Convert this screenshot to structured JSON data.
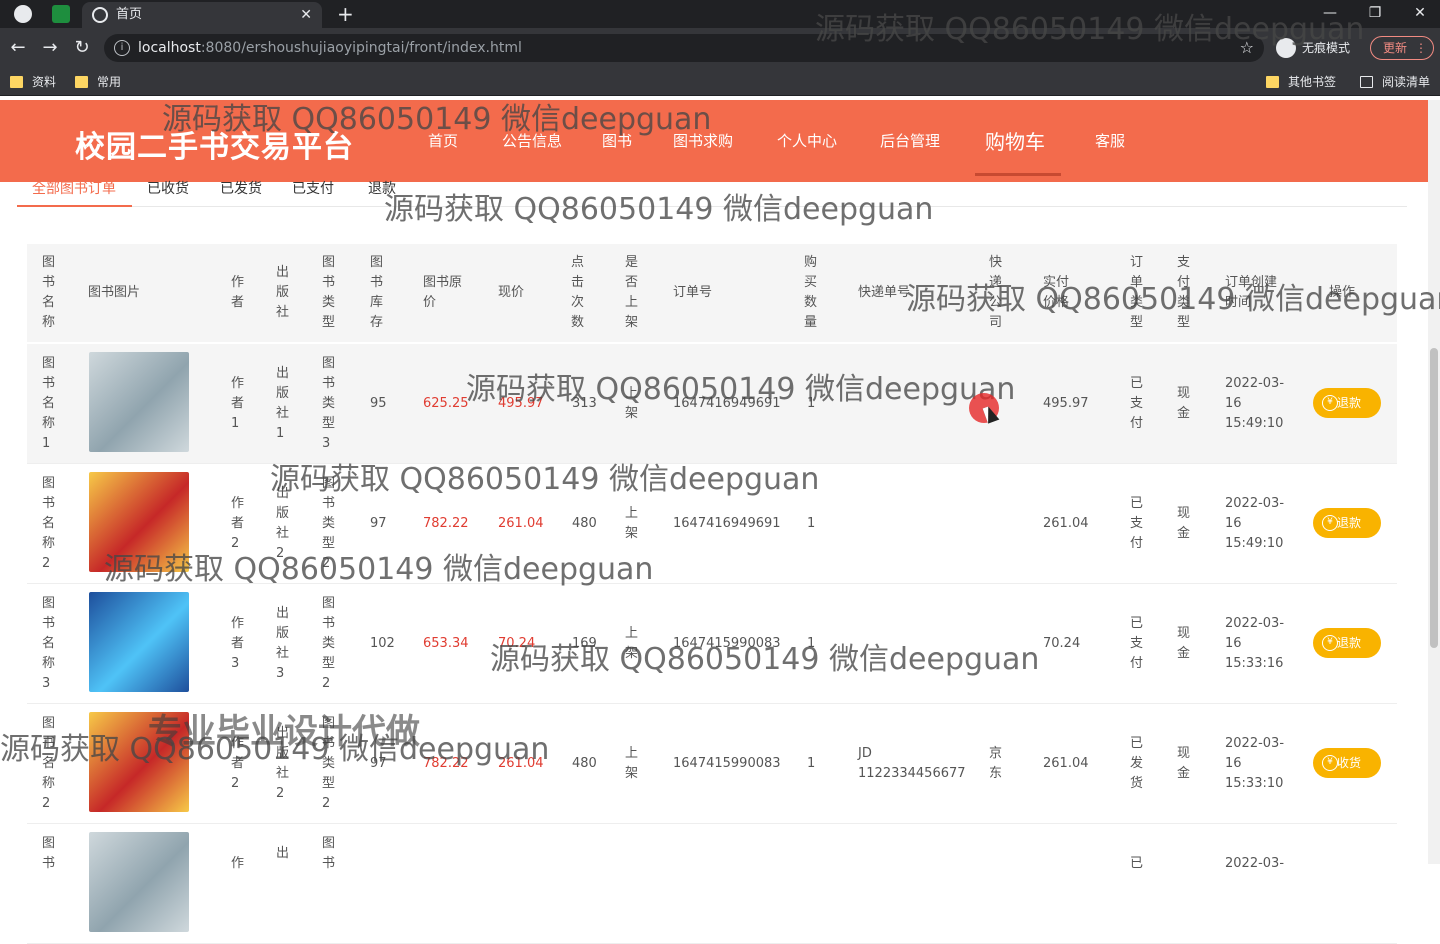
{
  "browser": {
    "tab_title": "首页",
    "url_host": "localhost",
    "url_path": ":8080/ershoushujiaoyipingtai/front/index.html",
    "incognito_label": "无痕模式",
    "update_label": "更新",
    "bookmarks": [
      "资料",
      "常用"
    ],
    "bookmarks_right": [
      "其他书签",
      "阅读清单"
    ]
  },
  "site": {
    "title": "校园二手书交易平台",
    "nav": [
      "首页",
      "公告信息",
      "图书",
      "图书求购",
      "个人中心",
      "后台管理",
      "购物车",
      "客服"
    ],
    "active_nav": "购物车"
  },
  "order_tabs": [
    "全部图书订单",
    "已收货",
    "已发货",
    "已支付",
    "退款"
  ],
  "table": {
    "headers": [
      "图书名称",
      "图书图片",
      "作者",
      "出版社",
      "图书类型",
      "图书库存",
      "图书原价",
      "现价",
      "点击次数",
      "是否上架",
      "订单号",
      "购买数量",
      "快递单号",
      "快递公司",
      "实付价格",
      "订单类型",
      "支付类型",
      "订单创建时间",
      "操作"
    ],
    "rows": [
      {
        "name": "图书名称1",
        "author": "作者1",
        "publisher": "出版社1",
        "type": "图书类型3",
        "stock": "95",
        "original": "625.25",
        "price": "495.97",
        "clicks": "313",
        "listed": "上架",
        "order_no": "1647416949691",
        "qty": "1",
        "tracking": "",
        "courier": "",
        "paid": "495.97",
        "order_type": "已支付",
        "pay_type": "现金",
        "created_date": "2022-03-",
        "created_day": "16",
        "created_time": "15:49:10",
        "action": "退款"
      },
      {
        "name": "图书名称2",
        "author": "作者2",
        "publisher": "出版社2",
        "type": "图书类型2",
        "stock": "97",
        "original": "782.22",
        "price": "261.04",
        "clicks": "480",
        "listed": "上架",
        "order_no": "1647416949691",
        "qty": "1",
        "tracking": "",
        "courier": "",
        "paid": "261.04",
        "order_type": "已支付",
        "pay_type": "现金",
        "created_date": "2022-03-",
        "created_day": "16",
        "created_time": "15:49:10",
        "action": "退款"
      },
      {
        "name": "图书名称3",
        "author": "作者3",
        "publisher": "出版社3",
        "type": "图书类型2",
        "stock": "102",
        "original": "653.34",
        "price": "70.24",
        "clicks": "169",
        "listed": "上架",
        "order_no": "1647415990083",
        "qty": "1",
        "tracking": "",
        "courier": "",
        "paid": "70.24",
        "order_type": "已支付",
        "pay_type": "现金",
        "created_date": "2022-03-",
        "created_day": "16",
        "created_time": "15:33:16",
        "action": "退款"
      },
      {
        "name": "图书名称2",
        "author": "作者2",
        "publisher": "出版社2",
        "type": "图书类型2",
        "stock": "97",
        "original": "782.22",
        "price": "261.04",
        "clicks": "480",
        "listed": "上架",
        "order_no": "1647415990083",
        "qty": "1",
        "tracking": "JD 1122334456677",
        "courier": "京东",
        "paid": "261.04",
        "order_type": "已发货",
        "pay_type": "现金",
        "created_date": "2022-03-",
        "created_day": "16",
        "created_time": "15:33:10",
        "action": "收货"
      },
      {
        "name": "图书",
        "author": "作",
        "publisher": "出",
        "type": "图书",
        "order_type": "已",
        "created_date": "2022-03-"
      }
    ]
  },
  "watermarks": [
    "源码获取 QQ86050149 微信deepguan",
    "专业毕业设计代做"
  ],
  "colors": {
    "header": "#f36b4c",
    "price_red": "#e03c31",
    "action_button": "#f9b300"
  }
}
